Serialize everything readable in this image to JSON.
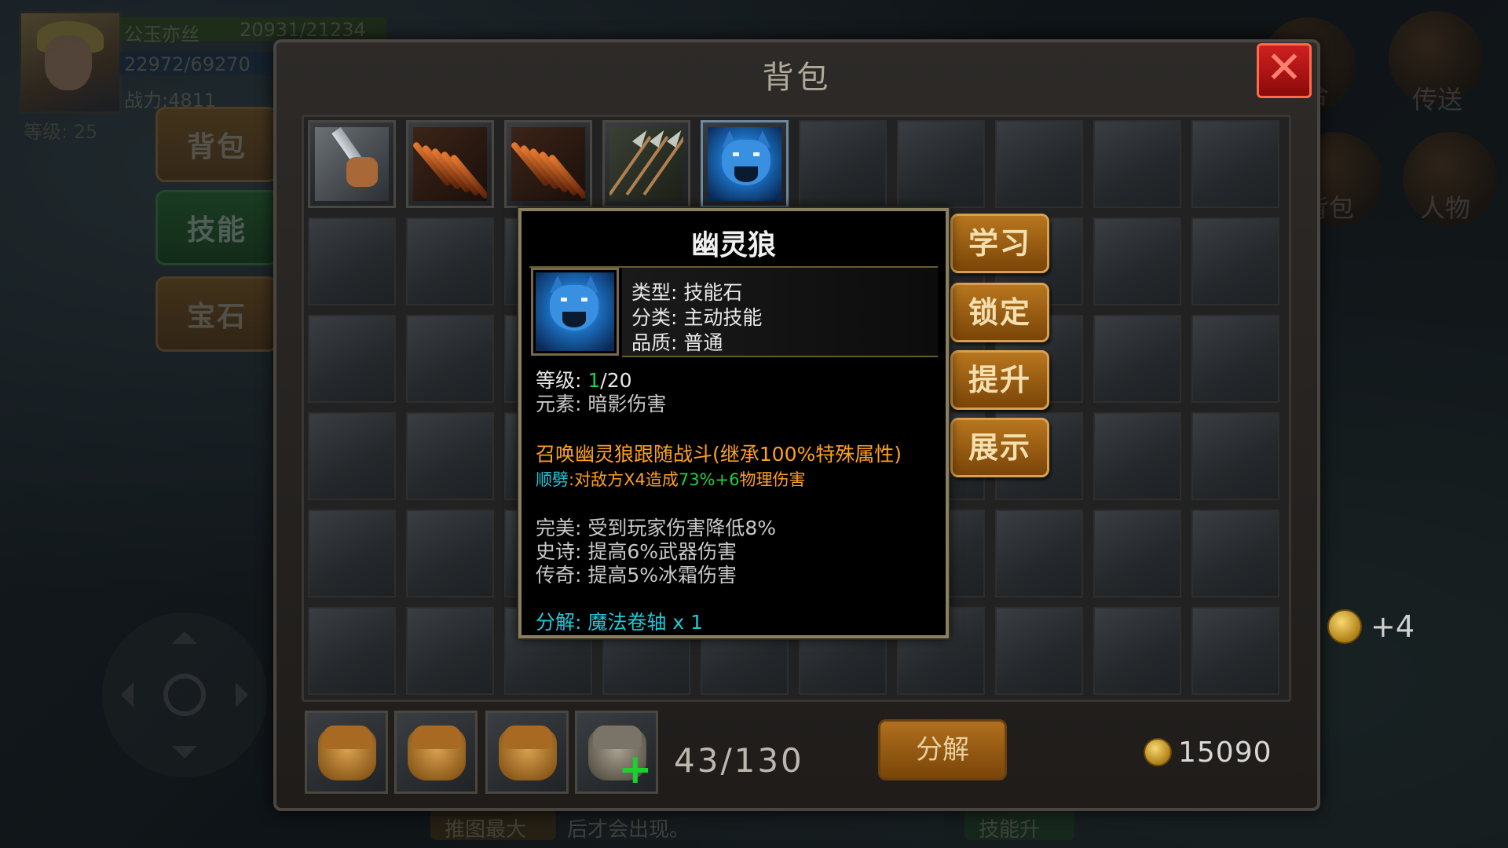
{
  "hud": {
    "player_name": "公玉亦丝",
    "hp": "20931/21234",
    "mp": "22972/69270",
    "power": "战力:4811",
    "level": "等级: 25"
  },
  "side_tabs": [
    {
      "label": "背包",
      "color": "orange"
    },
    {
      "label": "技能",
      "color": "green"
    },
    {
      "label": "宝石",
      "color": "orange"
    }
  ],
  "right_hud": {
    "top_label_1": "合",
    "top_label_2": "传送",
    "bag_label": "背包",
    "character_label": "人物",
    "reward": "+4"
  },
  "bag": {
    "title": "背包",
    "close_symbol": "✕",
    "capacity": "43/130",
    "decompose_label": "分解",
    "gold": "15090"
  },
  "items": [
    {
      "icon": "sword-fist-icon",
      "art": "sword"
    },
    {
      "icon": "claw-streak-icon",
      "art": "claw"
    },
    {
      "icon": "claw-streak-icon",
      "art": "claw"
    },
    {
      "icon": "spear-volley-icon",
      "art": "spear"
    },
    {
      "icon": "ghost-wolf-icon",
      "art": "wolf"
    }
  ],
  "tooltip": {
    "title": "幽灵狼",
    "type_label": "类型:",
    "type_value": "技能石",
    "category_label": "分类:",
    "category_value": "主动技能",
    "quality_label": "品质:",
    "quality_value": "普通",
    "level_label": "等级:",
    "level_current": "1",
    "level_max": "/20",
    "element_label": "元素:",
    "element_value": "暗影伤害",
    "desc_main": "召唤幽灵狼跟随战斗(继承100%特殊属性)",
    "desc_skill_name": "顺劈",
    "desc_skill_a": ":对敌方X4造成",
    "desc_skill_b": "73%+6",
    "desc_skill_c": "物理伤害",
    "perfect": "完美: 受到玩家伤害降低8%",
    "epic": "史诗: 提高6%武器伤害",
    "legend": "传奇: 提高5%冰霜伤害",
    "decompose_label": "分解:",
    "decompose_value": "魔法卷轴 x 1"
  },
  "actions": [
    "学习",
    "锁定",
    "提升",
    "展示"
  ],
  "bottom_hints": [
    "推图最大",
    "后才会出现。",
    "技能升"
  ],
  "colors": {
    "accent_orange": "#ffa020",
    "skill_green": "#20d040",
    "decompose_cyan": "#20c8d8",
    "close_red": "#d02020"
  }
}
